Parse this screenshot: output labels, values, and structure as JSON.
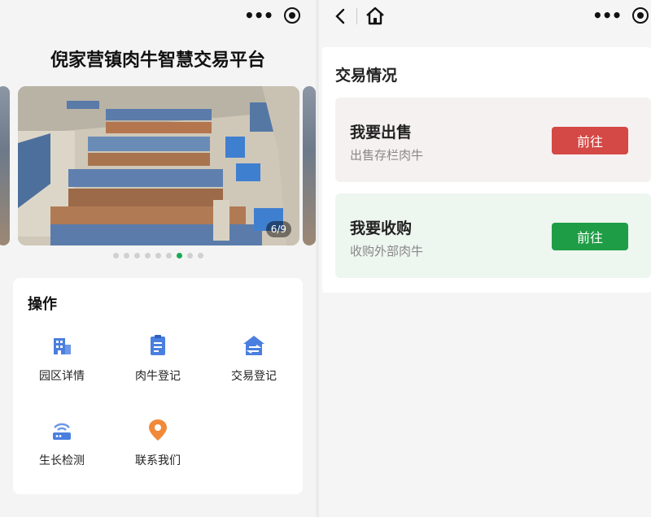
{
  "left_screen": {
    "capsule": {
      "more_icon": "more-dots-icon",
      "close_icon": "target-circle-icon"
    },
    "app_title": "倪家营镇肉牛智慧交易平台",
    "carousel": {
      "counter": "6/9",
      "total": 9,
      "active_index": 6
    },
    "operations": {
      "title": "操作",
      "items": [
        {
          "label": "园区详情",
          "icon": "building-icon"
        },
        {
          "label": "肉牛登记",
          "icon": "clipboard-icon"
        },
        {
          "label": "交易登记",
          "icon": "house-exchange-icon"
        },
        {
          "label": "生长检测",
          "icon": "router-signal-icon"
        },
        {
          "label": "联系我们",
          "icon": "location-pin-icon"
        }
      ]
    }
  },
  "right_screen": {
    "nav": {
      "back_icon": "chevron-left-icon",
      "home_icon": "home-icon",
      "more_icon": "more-dots-icon",
      "close_icon": "target-circle-icon"
    },
    "trade_section": {
      "title": "交易情况",
      "sell": {
        "title": "我要出售",
        "subtitle": "出售存栏肉牛",
        "button": "前往"
      },
      "buy": {
        "title": "我要收购",
        "subtitle": "收购外部肉牛",
        "button": "前往"
      }
    }
  },
  "colors": {
    "sell_button": "#d44845",
    "buy_button": "#1f9d46",
    "icon_blue": "#4a7fe0",
    "pin_orange": "#f08a3a",
    "indicator_active": "#1aaa55"
  }
}
